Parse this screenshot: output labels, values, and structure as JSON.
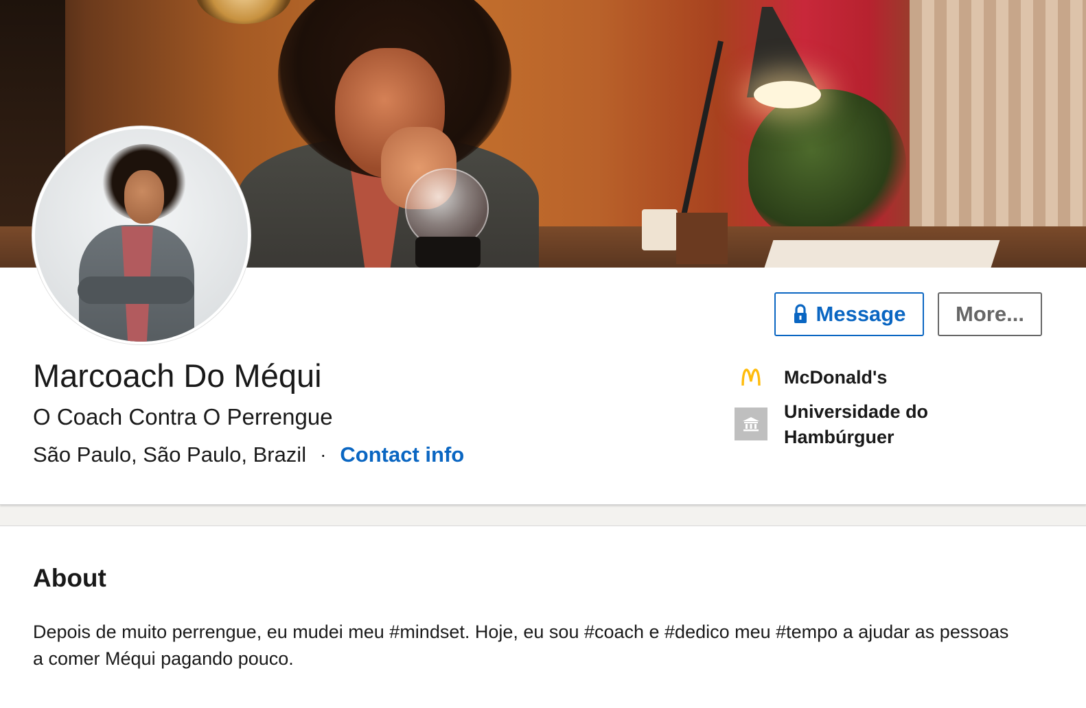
{
  "profile": {
    "name": "Marcoach Do Méqui",
    "headline": "O Coach Contra O Perrengue",
    "location": "São Paulo, São Paulo, Brazil",
    "separator": "·",
    "contact_info_label": "Contact info"
  },
  "actions": {
    "message_label": "Message",
    "more_label": "More..."
  },
  "experience": {
    "company": "McDonald's",
    "company_icon": "mcdonalds-logo-icon",
    "school": "Universidade do Hambúrguer",
    "school_icon": "school-building-icon"
  },
  "about": {
    "title": "About",
    "text": "Depois de muito perrengue, eu mudei meu #mindset. Hoje, eu sou #coach e #dedico meu #tempo a ajudar as pessoas a comer Méqui pagando pouco."
  },
  "colors": {
    "link_blue": "#0a66c2",
    "mcdonalds_yellow": "#ffbc0d",
    "muted_gray": "#666666"
  }
}
